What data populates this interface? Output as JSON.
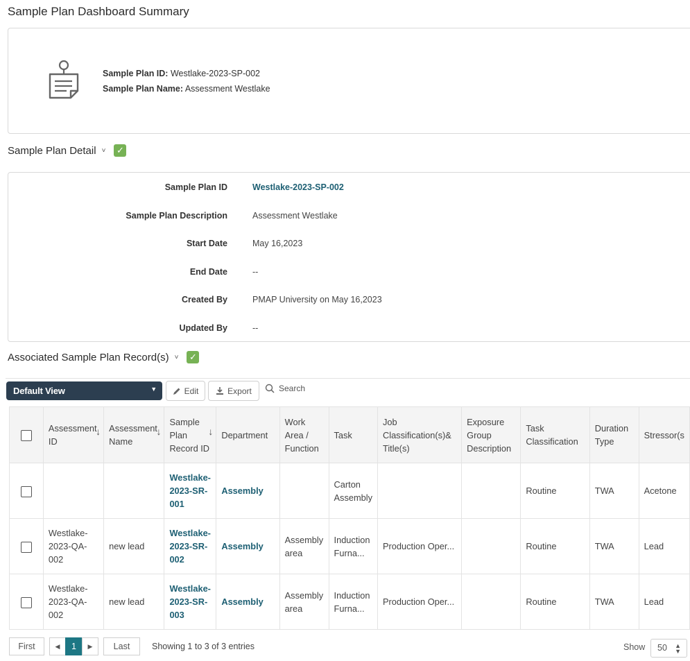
{
  "page": {
    "title": "Sample Plan Dashboard Summary"
  },
  "summary": {
    "icon": "clipboard-document-icon",
    "id_label": "Sample Plan ID:",
    "id_value": "Westlake-2023-SP-002",
    "name_label": "Sample Plan Name:",
    "name_value": "Assessment Westlake"
  },
  "detail": {
    "heading": "Sample Plan Detail",
    "rows": [
      {
        "label": "Sample Plan ID",
        "value": "Westlake-2023-SP-002"
      },
      {
        "label": "Sample Plan Description",
        "value": "Assessment Westlake"
      },
      {
        "label": "Start Date",
        "value": "May 16,2023"
      },
      {
        "label": "End Date",
        "value": "--"
      },
      {
        "label": "Created By",
        "value": "PMAP University on May 16,2023"
      },
      {
        "label": "Updated By",
        "value": "--"
      }
    ]
  },
  "records": {
    "heading": "Associated Sample Plan Record(s)",
    "toolbar": {
      "view_select": "Default View",
      "edit_label": "Edit",
      "export_label": "Export",
      "search_label": "Search"
    },
    "columns": [
      "Assessment ID",
      "Assessment Name",
      "Sample Plan Record ID",
      "Department",
      "Work Area / Function",
      "Task",
      "Job Classification(s)& Title(s)",
      "Exposure Group Description",
      "Task Classification",
      "Duration Type",
      "Stressor(s"
    ],
    "rows": [
      {
        "assessment_id": "",
        "assessment_name": "",
        "record_id": "Westlake-2023-SR-001",
        "department": "Assembly",
        "work_area": "",
        "task": "Carton Assembly",
        "job_class": "",
        "exposure_group": "",
        "task_class": "Routine",
        "duration": "TWA",
        "stressor": "Acetone"
      },
      {
        "assessment_id": "Westlake-2023-QA-002",
        "assessment_name": "new lead",
        "record_id": "Westlake-2023-SR-002",
        "department": "Assembly",
        "work_area": "Assembly area",
        "task": "Induction Furna...",
        "job_class": "Production Oper...",
        "exposure_group": "",
        "task_class": "Routine",
        "duration": "TWA",
        "stressor": "Lead"
      },
      {
        "assessment_id": "Westlake-2023-QA-002",
        "assessment_name": "new lead",
        "record_id": "Westlake-2023-SR-003",
        "department": "Assembly",
        "work_area": "Assembly area",
        "task": "Induction Furna...",
        "job_class": "Production Oper...",
        "exposure_group": "",
        "task_class": "Routine",
        "duration": "TWA",
        "stressor": "Lead"
      }
    ],
    "pagination": {
      "first": "First",
      "last": "Last",
      "current_page": "1",
      "showing": "Showing 1 to 3 of 3 entries",
      "show_label": "Show",
      "page_size": "50"
    }
  }
}
